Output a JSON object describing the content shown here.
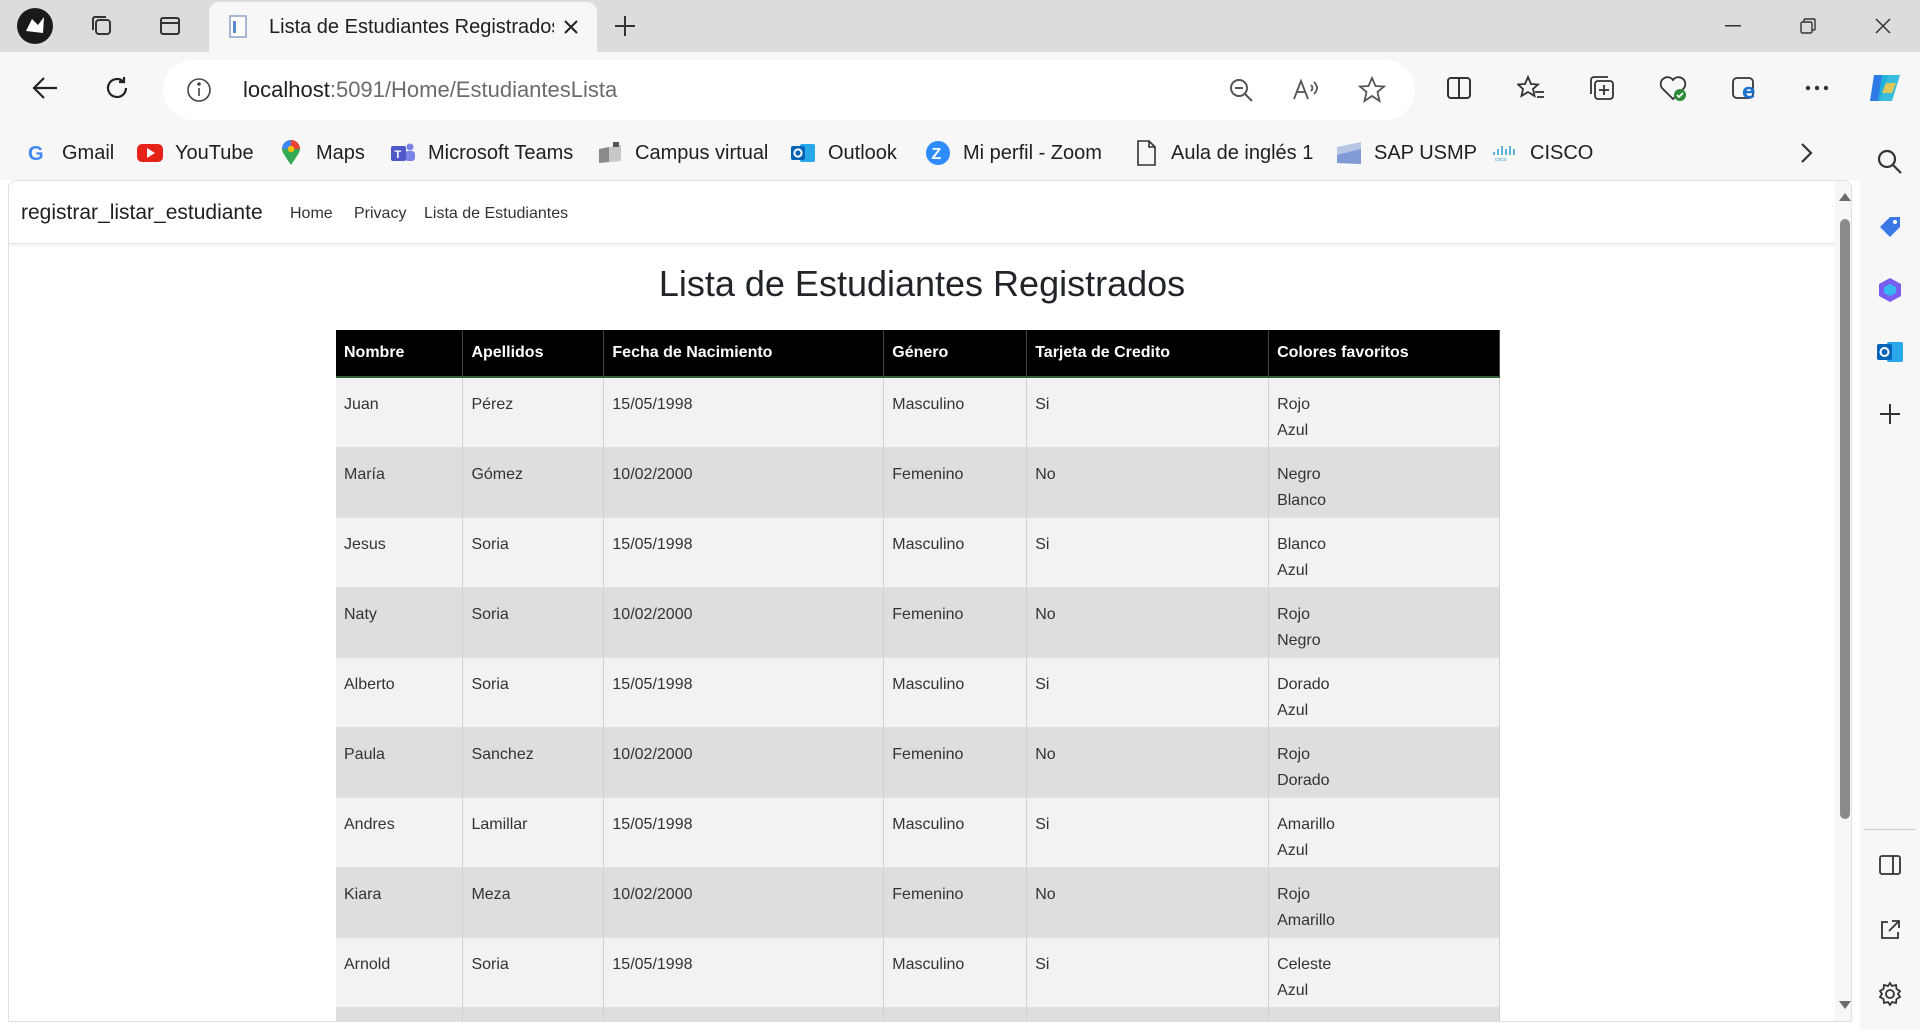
{
  "browser": {
    "tab_title": "Lista de Estudiantes Registrados",
    "url_host": "localhost",
    "url_rest": ":5091/Home/EstudiantesLista",
    "favorites": [
      {
        "label": "Gmail",
        "icon": "gmail-icon"
      },
      {
        "label": "YouTube",
        "icon": "youtube-icon"
      },
      {
        "label": "Maps",
        "icon": "maps-icon"
      },
      {
        "label": "Microsoft Teams",
        "icon": "teams-icon"
      },
      {
        "label": "Campus virtual",
        "icon": "campus-icon"
      },
      {
        "label": "Outlook",
        "icon": "outlook-icon"
      },
      {
        "label": "Mi perfil - Zoom",
        "icon": "zoom-icon"
      },
      {
        "label": "Aula de inglés 1",
        "icon": "document-icon"
      },
      {
        "label": "SAP USMP",
        "icon": "sap-icon"
      },
      {
        "label": "CISCO",
        "icon": "cisco-icon"
      }
    ]
  },
  "site": {
    "brand": "registrar_listar_estudiante",
    "nav": [
      "Home",
      "Privacy",
      "Lista de Estudiantes"
    ],
    "page_title": "Lista de Estudiantes Registrados"
  },
  "table": {
    "headers": [
      "Nombre",
      "Apellidos",
      "Fecha de Nacimiento",
      "Género",
      "Tarjeta de Credito",
      "Colores favoritos"
    ],
    "rows": [
      {
        "nombre": "Juan",
        "apellidos": "Pérez",
        "fecha": "15/05/1998",
        "genero": "Masculino",
        "tarjeta": "Si",
        "color1": "Rojo",
        "color2": "Azul"
      },
      {
        "nombre": "María",
        "apellidos": "Gómez",
        "fecha": "10/02/2000",
        "genero": "Femenino",
        "tarjeta": "No",
        "color1": "Negro",
        "color2": "Blanco"
      },
      {
        "nombre": "Jesus",
        "apellidos": "Soria",
        "fecha": "15/05/1998",
        "genero": "Masculino",
        "tarjeta": "Si",
        "color1": "Blanco",
        "color2": "Azul"
      },
      {
        "nombre": "Naty",
        "apellidos": "Soria",
        "fecha": "10/02/2000",
        "genero": "Femenino",
        "tarjeta": "No",
        "color1": "Rojo",
        "color2": "Negro"
      },
      {
        "nombre": "Alberto",
        "apellidos": "Soria",
        "fecha": "15/05/1998",
        "genero": "Masculino",
        "tarjeta": "Si",
        "color1": "Dorado",
        "color2": "Azul"
      },
      {
        "nombre": "Paula",
        "apellidos": "Sanchez",
        "fecha": "10/02/2000",
        "genero": "Femenino",
        "tarjeta": "No",
        "color1": "Rojo",
        "color2": "Dorado"
      },
      {
        "nombre": "Andres",
        "apellidos": "Lamillar",
        "fecha": "15/05/1998",
        "genero": "Masculino",
        "tarjeta": "Si",
        "color1": "Amarillo",
        "color2": "Azul"
      },
      {
        "nombre": "Kiara",
        "apellidos": "Meza",
        "fecha": "10/02/2000",
        "genero": "Femenino",
        "tarjeta": "No",
        "color1": "Rojo",
        "color2": "Amarillo"
      },
      {
        "nombre": "Arnold",
        "apellidos": "Soria",
        "fecha": "15/05/1998",
        "genero": "Masculino",
        "tarjeta": "Si",
        "color1": "Celeste",
        "color2": "Azul"
      }
    ]
  }
}
